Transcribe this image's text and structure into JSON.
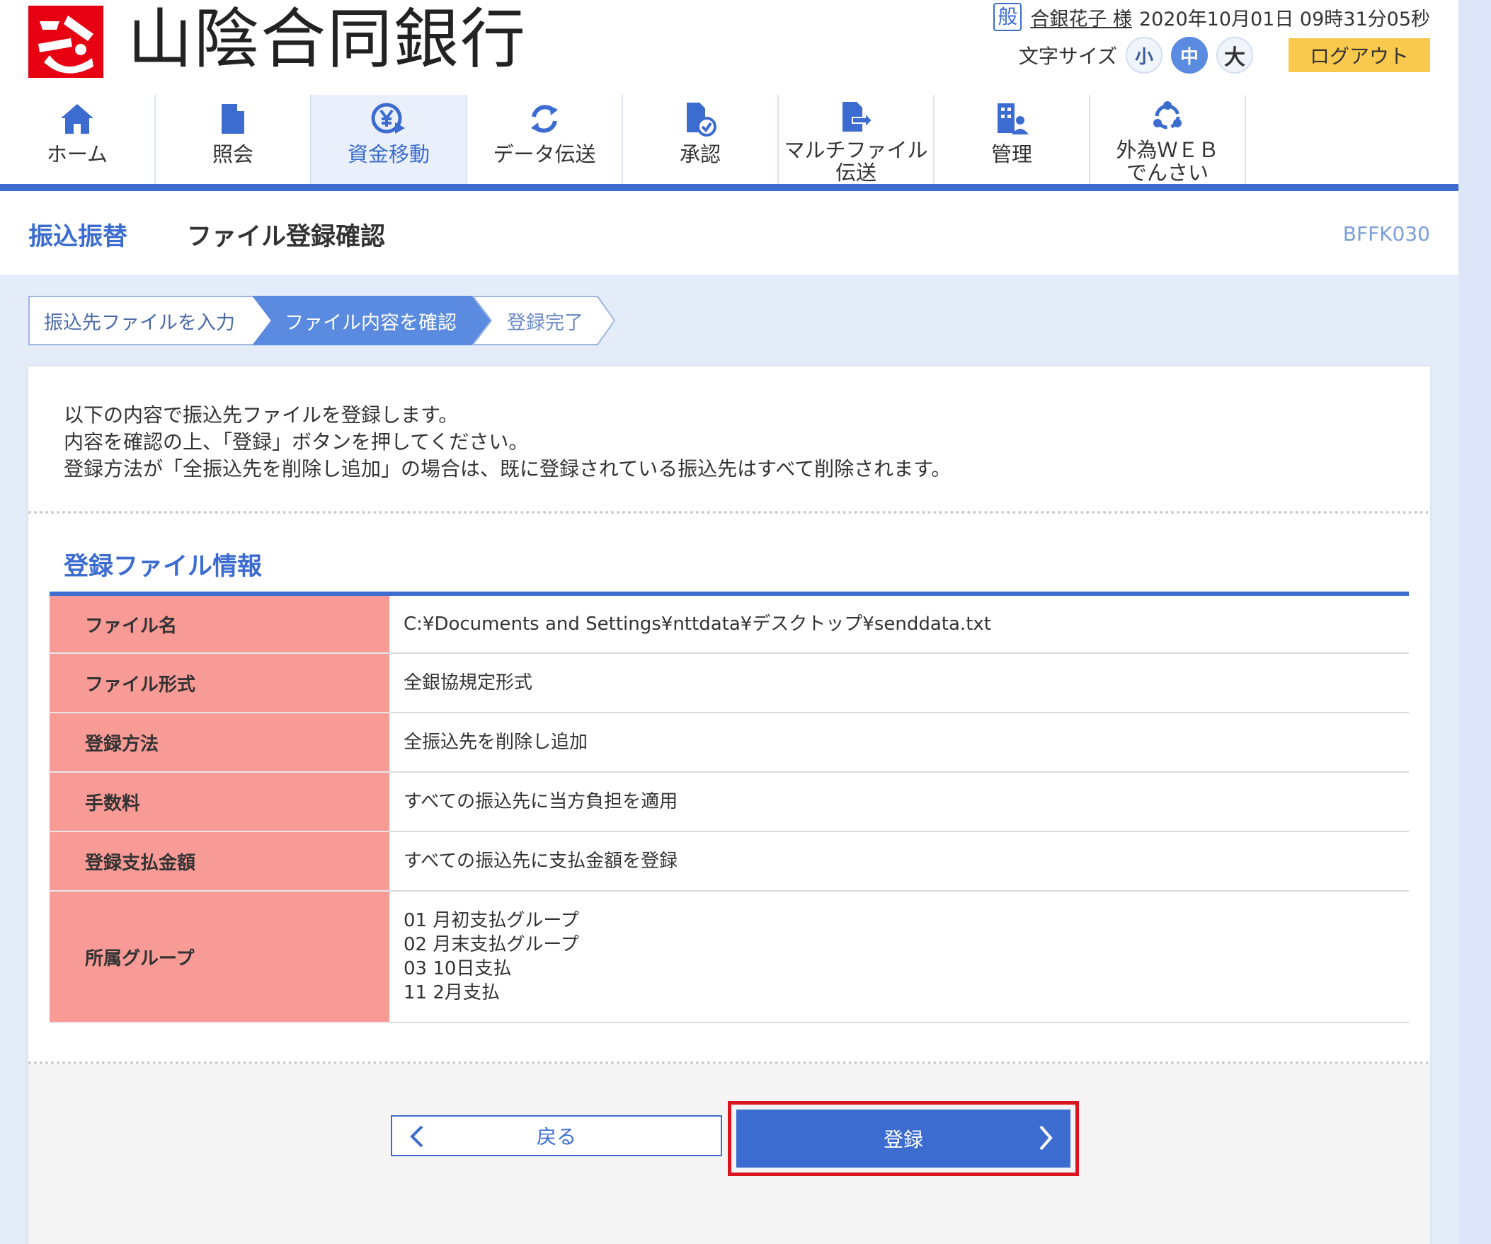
{
  "header": {
    "bank_name": "山陰合同銀行",
    "user_badge": "般",
    "user_name": "合銀花子 様",
    "datetime": "2020年10月01日 09時31分05秒",
    "font_size_label": "文字サイズ",
    "font_sizes": [
      "小",
      "中",
      "大"
    ],
    "logout_label": "ログアウト"
  },
  "nav": {
    "items": [
      {
        "label": "ホーム",
        "icon": "home-icon"
      },
      {
        "label": "照会",
        "icon": "document-icon"
      },
      {
        "label": "資金移動",
        "icon": "yen-transfer-icon"
      },
      {
        "label": "データ伝送",
        "icon": "refresh-icon"
      },
      {
        "label": "承認",
        "icon": "approve-icon"
      },
      {
        "label": "マルチファイル\n伝送",
        "icon": "file-export-icon"
      },
      {
        "label": "管理",
        "icon": "building-user-icon"
      },
      {
        "label": "外為ＷＥＢ\nでんさい",
        "icon": "cycle-icon"
      }
    ],
    "active_index": 2
  },
  "title": {
    "section": "振込振替",
    "page": "ファイル登録確認",
    "screen_id": "BFFK030"
  },
  "steps": [
    "振込先ファイルを入力",
    "ファイル内容を確認",
    "登録完了"
  ],
  "intro": {
    "line1": "以下の内容で振込先ファイルを登録します。",
    "line2": "内容を確認の上、「登録」ボタンを押してください。",
    "line3": "登録方法が「全振込先を削除し追加」の場合は、既に登録されている振込先はすべて削除されます。"
  },
  "file_info": {
    "title": "登録ファイル情報",
    "rows": [
      {
        "label": "ファイル名",
        "value": "C:¥Documents and Settings¥nttdata¥デスクトップ¥senddata.txt"
      },
      {
        "label": "ファイル形式",
        "value": "全銀協規定形式"
      },
      {
        "label": "登録方法",
        "value": "全振込先を削除し追加"
      },
      {
        "label": "手数料",
        "value": "すべての振込先に当方負担を適用"
      },
      {
        "label": "登録支払金額",
        "value": "すべての振込先に支払金額を登録"
      }
    ],
    "group_label": "所属グループ",
    "groups": [
      "01 月初支払グループ",
      "02 月末支払グループ",
      "03 10日支払",
      "11 2月支払"
    ]
  },
  "buttons": {
    "back": "戻る",
    "register": "登録"
  }
}
